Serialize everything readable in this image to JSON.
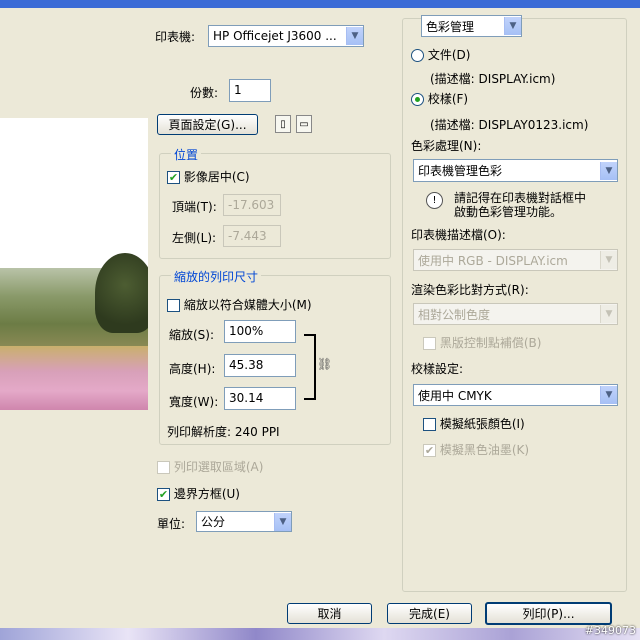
{
  "printer": {
    "label": "印表機:",
    "value": "HP Officejet J3600 ..."
  },
  "copies": {
    "label": "份數:",
    "value": "1"
  },
  "page_setup_button": "頁面設定(G)...",
  "position": {
    "title": "位置",
    "center_label": "影像居中(C)",
    "center_checked": true,
    "top_label": "頂端(T):",
    "top_value": "-17.603",
    "left_label": "左側(L):",
    "left_value": "-7.443"
  },
  "scaled_size": {
    "title": "縮放的列印尺寸",
    "fit_label": "縮放以符合媒體大小(M)",
    "scale_label": "縮放(S):",
    "scale_value": "100%",
    "height_label": "高度(H):",
    "height_value": "45.38",
    "width_label": "寬度(W):",
    "width_value": "30.14",
    "resolution": "列印解析度: 240 PPI"
  },
  "print_selected": "列印選取區域(A)",
  "bounding_box": "邊界方框(U)",
  "units": {
    "label": "單位:",
    "value": "公分"
  },
  "color_mgmt": {
    "header": "色彩管理",
    "document_label": "文件(D)",
    "document_profile": "(描述檔: DISPLAY.icm)",
    "proof_label": "校樣(F)",
    "proof_profile": "(描述檔: DISPLAY0123.icm)",
    "handling_label": "色彩處理(N):",
    "handling_value": "印表機管理色彩",
    "note_line1": "請記得在印表機對話框中",
    "note_line2": "啟動色彩管理功能。",
    "printer_profile_label": "印表機描述檔(O):",
    "printer_profile_value": "使用中 RGB - DISPLAY.icm",
    "intent_label": "渲染色彩比對方式(R):",
    "intent_value": "相對公制色度",
    "bpc_label": "黑版控制點補償(B)",
    "proof_setup_label": "校樣設定:",
    "proof_setup_value": "使用中 CMYK",
    "sim_paper_label": "模擬紙張顏色(I)",
    "sim_black_label": "模擬黑色油墨(K)"
  },
  "buttons": {
    "cancel": "取消",
    "done": "完成(E)",
    "print": "列印(P)..."
  },
  "watermark": "#349073"
}
